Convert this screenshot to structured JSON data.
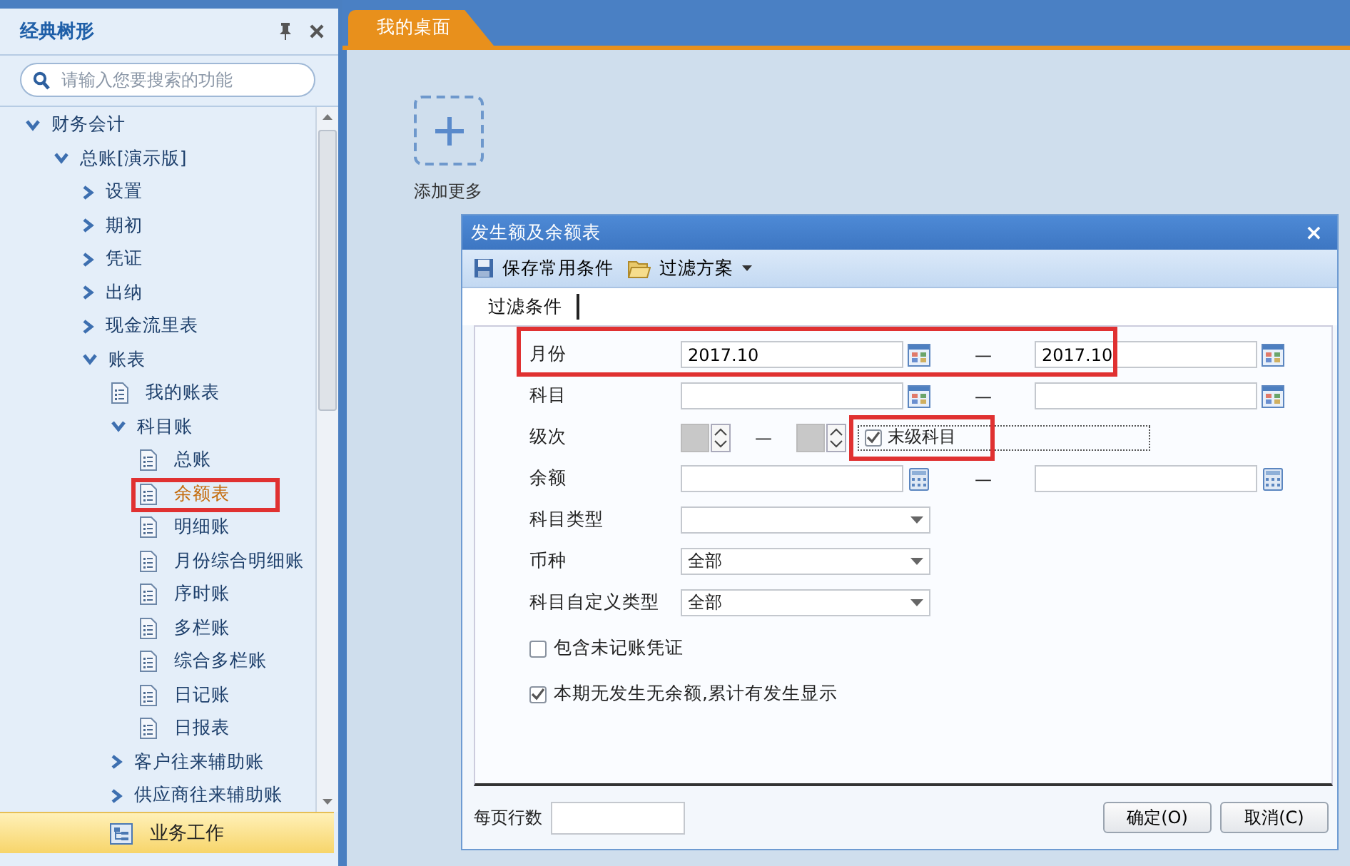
{
  "sidebar": {
    "title": "经典树形",
    "search": {
      "placeholder": "请输入您要搜索的功能"
    },
    "tree": [
      {
        "label": "财务会计",
        "kind": "folder",
        "expanded": true,
        "children": [
          {
            "label": "总账[演示版]",
            "kind": "folder",
            "expanded": true,
            "children": [
              {
                "label": "设置",
                "kind": "folder",
                "expanded": false
              },
              {
                "label": "期初",
                "kind": "folder",
                "expanded": false
              },
              {
                "label": "凭证",
                "kind": "folder",
                "expanded": false
              },
              {
                "label": "出纳",
                "kind": "folder",
                "expanded": false
              },
              {
                "label": "现金流里表",
                "kind": "folder",
                "expanded": false
              },
              {
                "label": "账表",
                "kind": "folder",
                "expanded": true,
                "children": [
                  {
                    "label": "我的账表",
                    "kind": "report",
                    "selected": false,
                    "marked": false
                  },
                  {
                    "label": "科目账",
                    "kind": "folder",
                    "expanded": true,
                    "children": [
                      {
                        "label": "总账",
                        "kind": "report",
                        "selected": false,
                        "marked": false
                      },
                      {
                        "label": "余额表",
                        "kind": "report",
                        "selected": true,
                        "marked": true
                      },
                      {
                        "label": "明细账",
                        "kind": "report",
                        "selected": false,
                        "marked": false
                      },
                      {
                        "label": "月份综合明细账",
                        "kind": "report",
                        "selected": false,
                        "marked": false
                      },
                      {
                        "label": "序时账",
                        "kind": "report",
                        "selected": false,
                        "marked": false
                      },
                      {
                        "label": "多栏账",
                        "kind": "report",
                        "selected": false,
                        "marked": false
                      },
                      {
                        "label": "综合多栏账",
                        "kind": "report",
                        "selected": false,
                        "marked": false
                      },
                      {
                        "label": "日记账",
                        "kind": "report",
                        "selected": false,
                        "marked": false
                      },
                      {
                        "label": "日报表",
                        "kind": "report",
                        "selected": false,
                        "marked": false
                      }
                    ]
                  },
                  {
                    "label": "客户往来辅助账",
                    "kind": "folder",
                    "expanded": false
                  },
                  {
                    "label": "供应商往来辅助账",
                    "kind": "folder",
                    "expanded": false
                  }
                ]
              }
            ]
          }
        ]
      }
    ],
    "bottom_item": {
      "label": "业务工作"
    }
  },
  "tabs": [
    {
      "label": "我的桌面",
      "selected": true
    }
  ],
  "desktop": {
    "add_tile": {
      "label": "添加更多"
    }
  },
  "dialog": {
    "title": "发生额及余额表",
    "close": "×",
    "toolbar": [
      {
        "label": "保存常用条件",
        "kind": "save",
        "dropdown": false
      },
      {
        "label": "过滤方案",
        "kind": "folder",
        "dropdown": true
      }
    ],
    "tabs": [
      {
        "label": "过滤条件",
        "selected": true
      }
    ],
    "rows": [
      {
        "kind": "range",
        "label": "月份",
        "marked": true,
        "dash": "—",
        "from": {
          "value": "2017.10",
          "kind": "calendar"
        },
        "to": {
          "value": "2017.10",
          "kind": "calendar"
        }
      },
      {
        "kind": "range",
        "label": "科目",
        "marked": false,
        "dash": "—",
        "from": {
          "kind": "calendar"
        },
        "to": {
          "kind": "calendar"
        }
      },
      {
        "kind": "level",
        "label": "级次",
        "dash": "—",
        "option": {
          "label": "末级科目",
          "checked": true,
          "marked": true
        }
      },
      {
        "kind": "range",
        "label": "余额",
        "marked": false,
        "dash": "—",
        "from": {
          "kind": "calculator"
        },
        "to": {
          "kind": "calculator"
        }
      },
      {
        "kind": "select",
        "label": "科目类型"
      },
      {
        "kind": "select",
        "label": "币种",
        "value": "全部"
      },
      {
        "kind": "select",
        "label": "科目自定义类型",
        "value": "全部"
      }
    ],
    "checks": [
      {
        "label": "包含未记账凭证",
        "checked": false
      },
      {
        "label": "本期无发生无余额,累计有发生显示",
        "checked": true
      }
    ],
    "page_rows": {
      "label": "每页行数"
    },
    "buttons": [
      "确定(O)",
      "取消(C)"
    ]
  }
}
